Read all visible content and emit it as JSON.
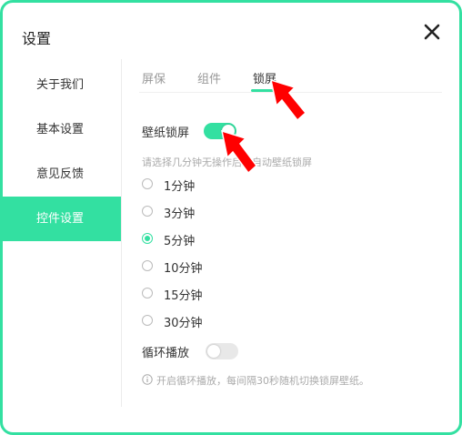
{
  "dialog": {
    "title": "设置"
  },
  "sidebar": {
    "items": [
      {
        "label": "关于我们"
      },
      {
        "label": "基本设置"
      },
      {
        "label": "意见反馈"
      },
      {
        "label": "控件设置"
      }
    ],
    "active_index": 3
  },
  "tabs": [
    {
      "label": "屏保"
    },
    {
      "label": "组件"
    },
    {
      "label": "锁屏"
    }
  ],
  "active_tab": "锁屏",
  "wallpaper_lock": {
    "label": "壁纸锁屏",
    "enabled": true
  },
  "lock_hint": "请选择几分钟无操作后，自动壁纸锁屏",
  "timeouts": {
    "options": [
      "1分钟",
      "3分钟",
      "5分钟",
      "10分钟",
      "15分钟",
      "30分钟"
    ],
    "selected": "5分钟"
  },
  "loop_play": {
    "label": "循环播放",
    "enabled": false
  },
  "loop_hint": "开启循环播放，每间隔30秒随机切换锁屏壁纸。",
  "colors": {
    "accent": "#33e0a1",
    "annotation_arrow": "#ff0000"
  },
  "icons": [
    "close-icon",
    "info-icon",
    "arrow-annotation"
  ]
}
